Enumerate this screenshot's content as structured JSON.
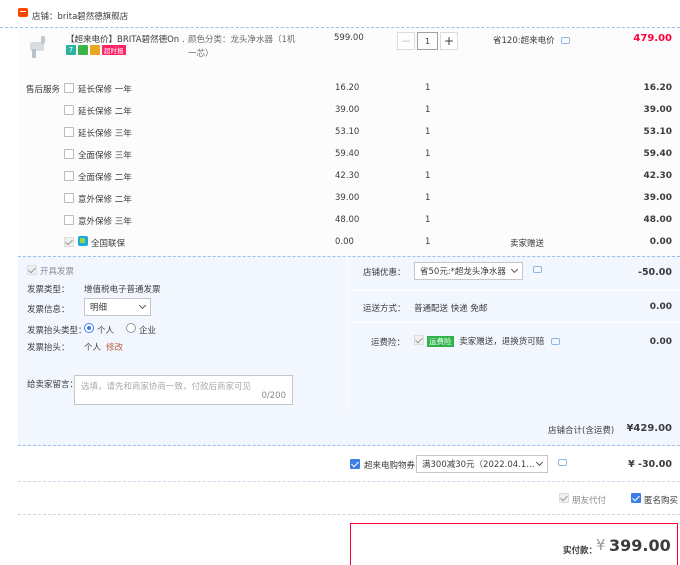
{
  "shop": {
    "label": "店铺：brita碧然德旗舰店"
  },
  "item": {
    "title": "【超来电价】BRITA碧然德On ...",
    "badges": [
      "7",
      "",
      "",
      "超时报"
    ],
    "sku_label": "颜色分类：龙头净水器（1机一芯）",
    "unit_price": "599.00",
    "quantity": "1",
    "qty_dec": "−",
    "qty_inc": "+",
    "savings": "省120:超来电价",
    "total": "479.00"
  },
  "services": {
    "heading": "售后服务",
    "rows": [
      {
        "name": "延长保修 一年",
        "price": "16.20",
        "qty": "1",
        "total": "16.20"
      },
      {
        "name": "延长保修 二年",
        "price": "39.00",
        "qty": "1",
        "total": "39.00"
      },
      {
        "name": "延长保修 三年",
        "price": "53.10",
        "qty": "1",
        "total": "53.10"
      },
      {
        "name": "全面保修 三年",
        "price": "59.40",
        "qty": "1",
        "total": "59.40"
      },
      {
        "name": "全面保修 二年",
        "price": "42.30",
        "qty": "1",
        "total": "42.30"
      },
      {
        "name": "意外保修 二年",
        "price": "39.00",
        "qty": "1",
        "total": "39.00"
      },
      {
        "name": "意外保修 三年",
        "price": "48.00",
        "qty": "1",
        "total": "48.00"
      }
    ],
    "lian": {
      "name": "全国联保",
      "price": "0.00",
      "qty": "1",
      "gift": "卖家赠送",
      "total": "0.00"
    }
  },
  "invoice": {
    "open_label": "开具发票",
    "type_label": "发票类型：",
    "type_value": "增值税电子普通发票",
    "info_label": "发票信息：",
    "info_value": "明细",
    "header_type_label": "发票抬头类型：",
    "personal": "个人",
    "company": "企业",
    "header_label": "发票抬头：",
    "header_value": "个人",
    "edit": "修改"
  },
  "message": {
    "label": "给卖家留言：",
    "placeholder": "选填，请先和商家协商一致，付款后商家可见",
    "count": "0/200"
  },
  "shop_discount": {
    "label": "店铺优惠：",
    "value": "省50元:*超龙头净水器",
    "amount": "-50.00"
  },
  "shipping": {
    "label": "运送方式：",
    "value": "普通配送 快递 免邮",
    "amount": "0.00"
  },
  "insurance": {
    "label": "运费险：",
    "badge": "运费险",
    "value": "卖家赠送，退换货可赔",
    "amount": "0.00"
  },
  "shop_total": {
    "label": "店铺合计(含运费)",
    "amount": "¥429.00"
  },
  "coupon": {
    "label": "超来电购物券",
    "value": "满300减30元（2022.04.1...",
    "amount": "¥ -30.00"
  },
  "options": {
    "friend_pay": "朋友代付",
    "anonymous": "匿名购买"
  },
  "payment": {
    "label": "实付款：",
    "currency": "¥",
    "amount": "399.00"
  },
  "colors": {
    "accent": "#ff0036",
    "blue": "#3c7ee8",
    "panel": "#f2f7ff"
  }
}
